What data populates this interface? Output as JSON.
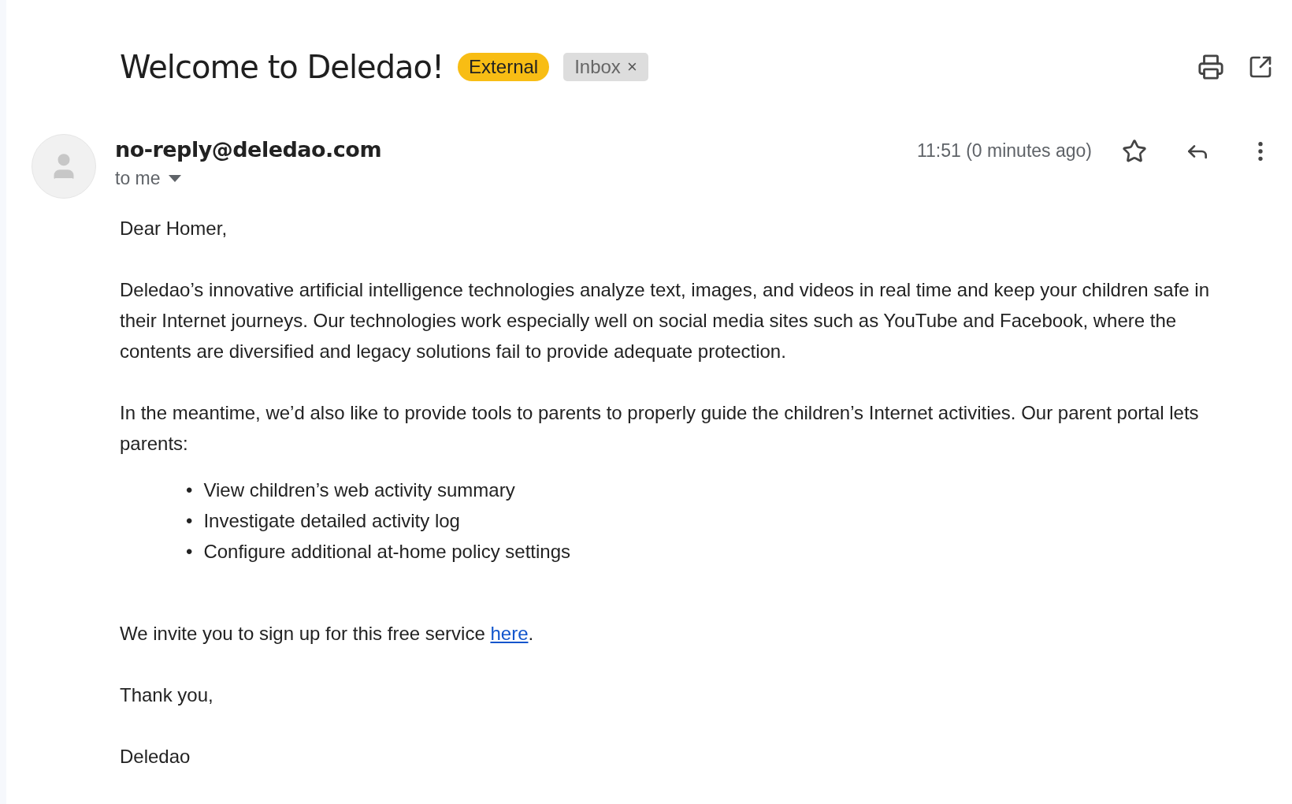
{
  "subject": "Welcome to Deledao!",
  "labels": [
    {
      "kind": "external",
      "text": "External"
    },
    {
      "kind": "inbox",
      "text": "Inbox",
      "remove": "×"
    }
  ],
  "sender": {
    "address": "no-reply@deledao.com",
    "recipient": "to me",
    "time": "11:51 (0 minutes ago)",
    "starred": false
  },
  "body": {
    "greeting": "Dear Homer,",
    "paragraphs": [
      "Deledao’s innovative artificial intelligence technologies analyze text, images, and videos in real time and keep your children safe in their Internet journeys. Our technologies work especially well on social media sites such as YouTube and Facebook, where the contents are diversified and legacy solutions fail to provide adequate protection.",
      "In the meantime, we’d also like to provide tools to parents to properly guide the children’s Internet activities. Our parent portal lets parents:"
    ],
    "bullets": [
      {
        "marker": "•",
        "text": "View children’s web activity summary"
      },
      {
        "marker": "•",
        "text": "Investigate detailed activity log"
      },
      {
        "marker": "•",
        "text": "Configure additional at-home policy settings"
      }
    ],
    "invite": {
      "before": "We invite you to sign up for this free service ",
      "link": "here",
      "after": "."
    },
    "closing": "Thank you,",
    "signature": "Deledao"
  }
}
